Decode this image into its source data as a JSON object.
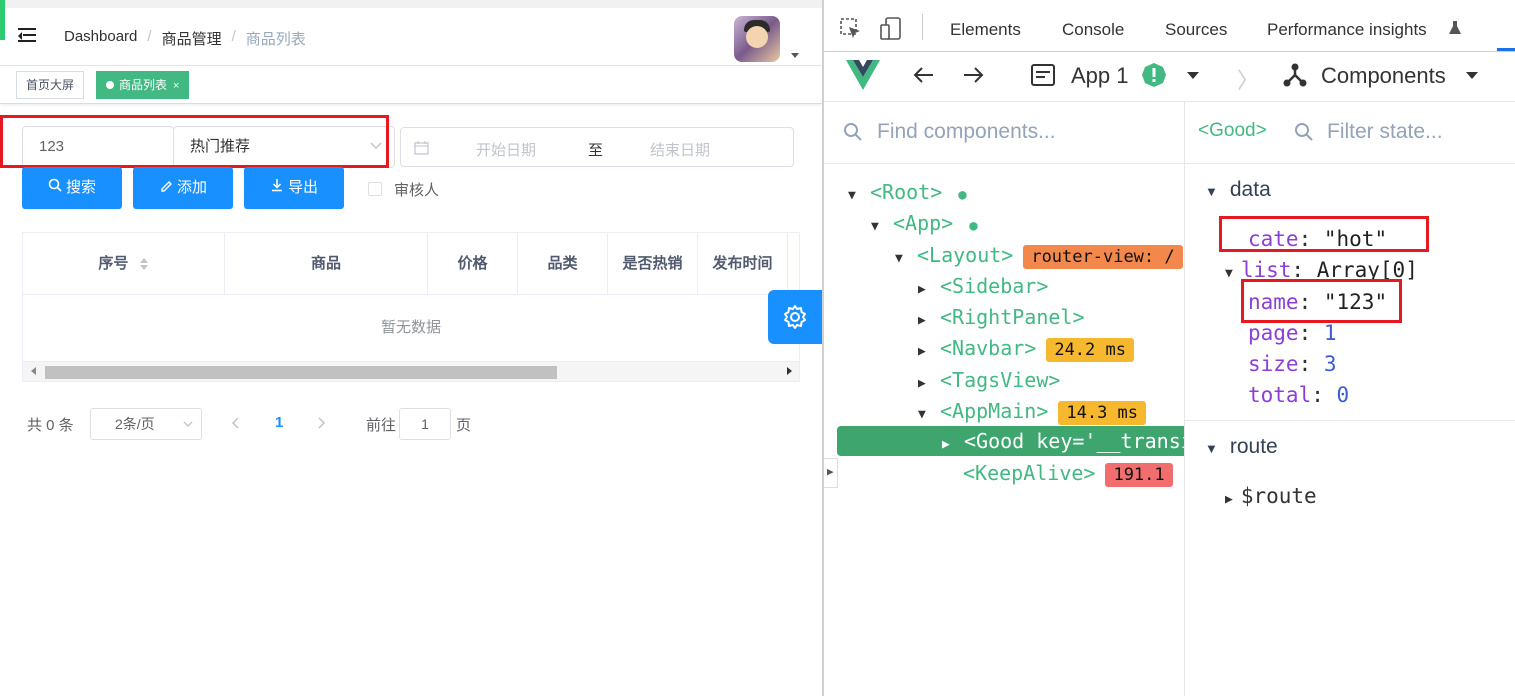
{
  "app": {
    "breadcrumb": [
      "Dashboard",
      "商品管理",
      "商品列表"
    ],
    "tags": [
      {
        "label": "首页大屏",
        "active": false
      },
      {
        "label": "商品列表",
        "active": true,
        "close": "×"
      }
    ],
    "filters": {
      "name_value": "123",
      "category_value": "热门推荐",
      "date_start_placeholder": "开始日期",
      "date_separator": "至",
      "date_end_placeholder": "结束日期"
    },
    "buttons": {
      "search": "搜索",
      "add": "添加",
      "export": "导出"
    },
    "checkbox_label": "审核人",
    "table": {
      "columns": [
        "序号",
        "商品",
        "价格",
        "品类",
        "是否热销",
        "发布时间"
      ],
      "empty_text": "暂无数据"
    },
    "pagination": {
      "total": "共 0 条",
      "page_size": "2条/页",
      "current_page": "1",
      "goto_label": "前往",
      "goto_value": "1",
      "page_suffix": "页"
    }
  },
  "devtools": {
    "tabs": [
      "Elements",
      "Console",
      "Sources",
      "Performance insights"
    ],
    "app_selector": "App 1",
    "view_selector": "Components",
    "find_placeholder": "Find components...",
    "selected_component": "<Good>",
    "filter_placeholder": "Filter state...",
    "tree": [
      {
        "label": "<Root>",
        "depth": 0,
        "expanded": true
      },
      {
        "label": "<App>",
        "depth": 1,
        "expanded": true
      },
      {
        "label": "<Layout>",
        "depth": 2,
        "expanded": true,
        "badge": "router-view: /",
        "badge_color": "#f2884b"
      },
      {
        "label": "<Sidebar>",
        "depth": 3,
        "expanded": false
      },
      {
        "label": "<RightPanel>",
        "depth": 3,
        "expanded": false
      },
      {
        "label": "<Navbar>",
        "depth": 3,
        "expanded": false,
        "badge": "24.2 ms",
        "badge_color": "#f5b82e"
      },
      {
        "label": "<TagsView>",
        "depth": 3,
        "expanded": false
      },
      {
        "label": "<AppMain>",
        "depth": 3,
        "expanded": true,
        "badge": "14.3 ms",
        "badge_color": "#f5b82e"
      },
      {
        "label": "<Good key='__transi",
        "depth": 4,
        "expanded": false,
        "selected": true
      },
      {
        "label": "<KeepAlive>",
        "depth": 4,
        "badge": "191.1",
        "badge_color": "#f26d6d"
      }
    ],
    "state": {
      "data_section": "data",
      "cate_key": "cate",
      "cate_value": "\"hot\"",
      "list_key": "list",
      "list_value": "Array[0]",
      "name_key": "name",
      "name_value": "\"123\"",
      "page_key": "page",
      "page_value": "1",
      "size_key": "size",
      "size_value": "3",
      "total_key": "total",
      "total_value": "0",
      "route_section": "route",
      "route_key": "$route"
    }
  },
  "colors": {
    "primary": "#1890ff",
    "tag_active": "#42b983",
    "vue_green": "#42b883",
    "highlight_red": "#e5191f"
  }
}
